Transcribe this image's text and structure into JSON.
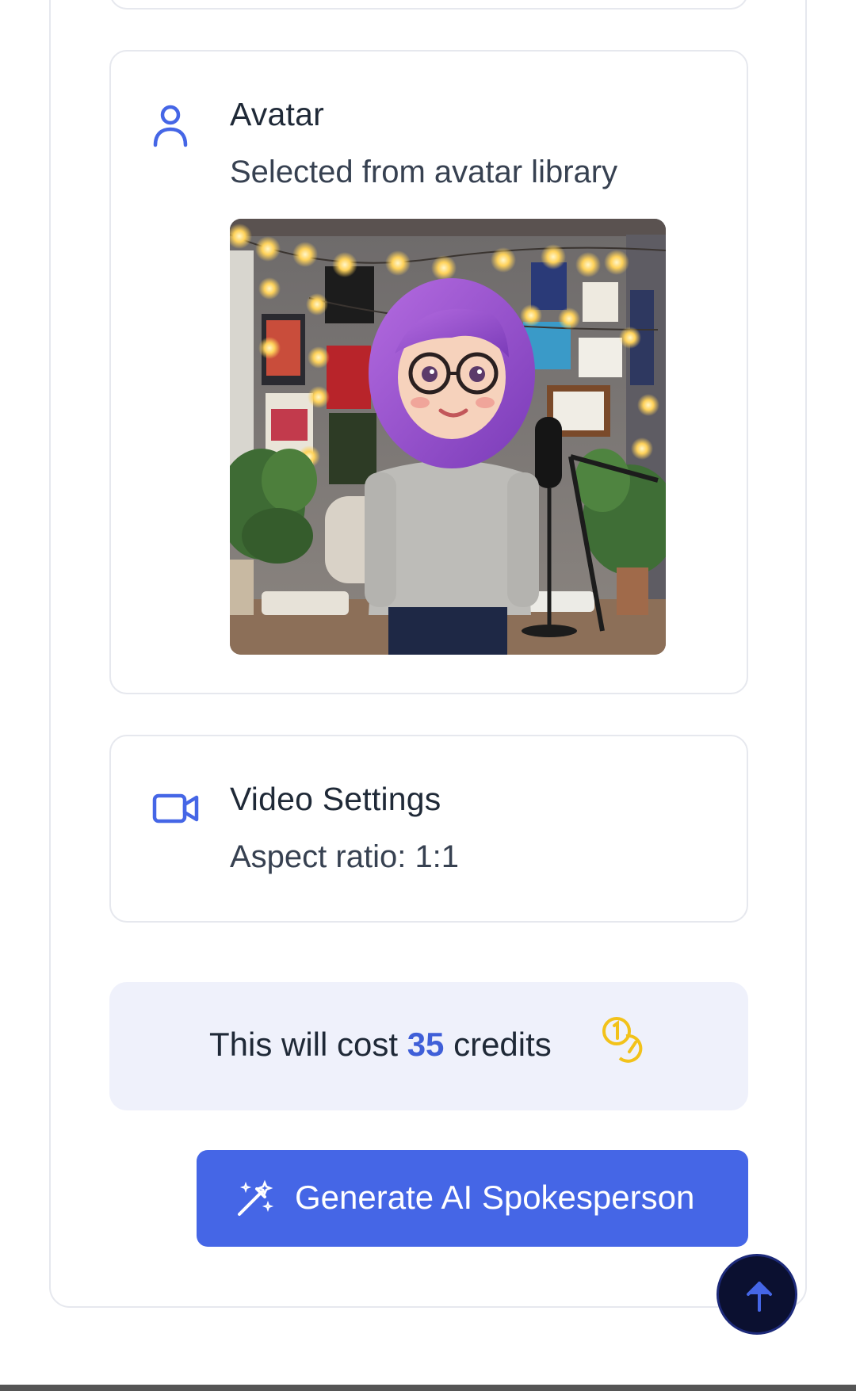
{
  "avatar_section": {
    "icon": "person-icon",
    "title": "Avatar",
    "subtitle": "Selected from avatar library",
    "image_description_icon": "avatar-image"
  },
  "video_settings": {
    "icon": "video-camera-icon",
    "title": "Video Settings",
    "subtitle": "Aspect ratio: 1:1"
  },
  "cost": {
    "prefix": "This will cost ",
    "amount": "35",
    "suffix": " credits",
    "icon": "coins-icon"
  },
  "generate_button": {
    "icon": "magic-wand-icon",
    "label": "Generate AI Spokesperson"
  },
  "scroll_top": {
    "icon": "arrow-up-icon"
  },
  "colors": {
    "accent": "#4566e6",
    "cost_number": "#3f5fd8",
    "coin": "#f2c21a",
    "cost_background": "#eff1fb",
    "scroll_button": "#0b1030"
  }
}
